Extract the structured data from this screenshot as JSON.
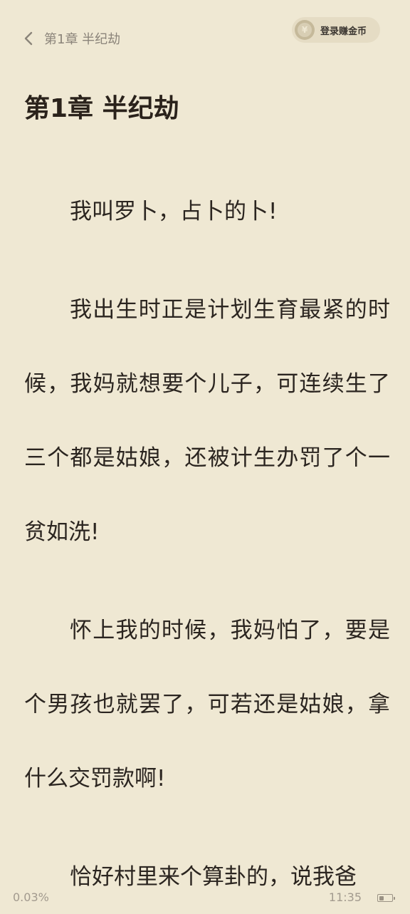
{
  "header": {
    "title": "第1章 半纪劫",
    "coin_button_label": "登录赚金币",
    "coin_symbol": "¥"
  },
  "chapter": {
    "title": "第1章 半纪劫",
    "paragraphs": [
      "我叫罗卜，占卜的卜!",
      "我出生时正是计划生育最紧的时候，我妈就想要个儿子，可连续生了三个都是姑娘，还被计生办罚了个一贫如洗!",
      "怀上我的时候，我妈怕了，要是个男孩也就罢了，可若还是姑娘，拿什么交罚款啊!",
      "恰好村里来个算卦的，说我爸"
    ]
  },
  "footer": {
    "progress": "0.03%",
    "time": "11:35",
    "battery_level": 0.35
  },
  "colors": {
    "background": "#efe8d3",
    "text": "#2b2520",
    "muted": "#a29a8e"
  }
}
